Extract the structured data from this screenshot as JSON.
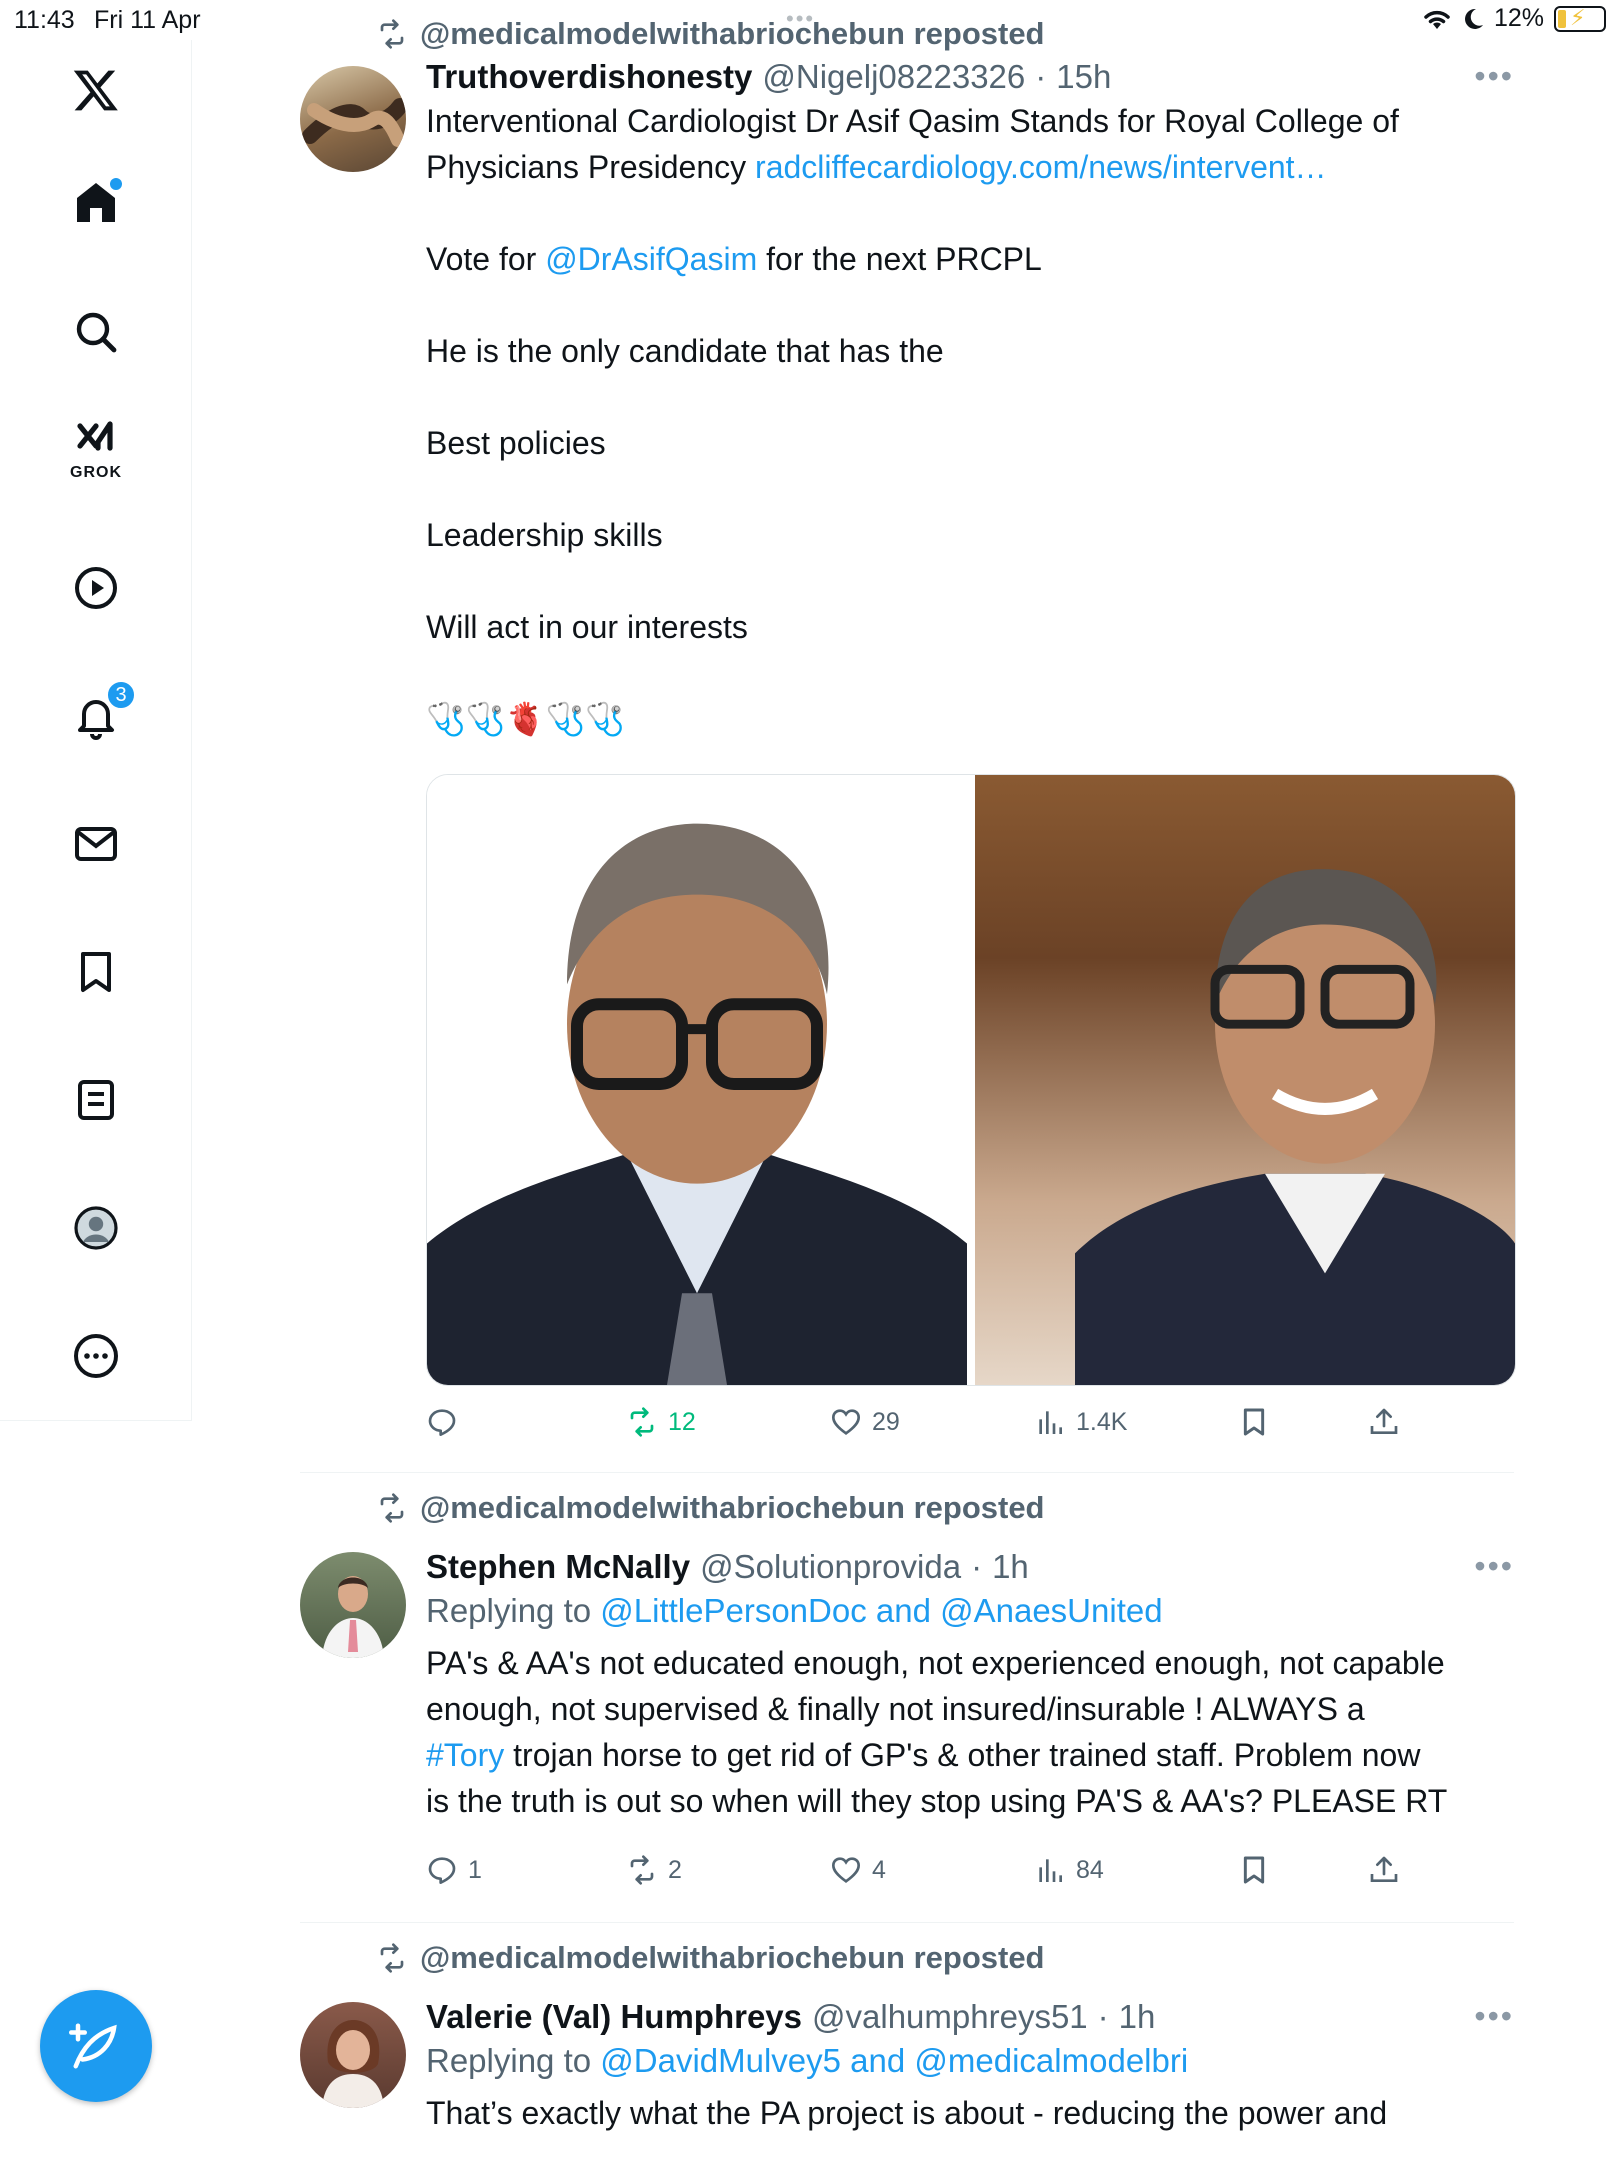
{
  "status_bar": {
    "time": "11:43",
    "date": "Fri 11 Apr",
    "battery": "12%"
  },
  "colors": {
    "accent": "#1d9bf0",
    "retweet_active": "#00ba7c",
    "secondary_text": "#536471"
  },
  "sidebar": {
    "items": [
      {
        "icon": "x-logo-icon"
      },
      {
        "icon": "home-icon"
      },
      {
        "icon": "search-icon"
      },
      {
        "icon": "grok-icon",
        "label": "GROK"
      },
      {
        "icon": "video-play-icon"
      },
      {
        "icon": "bell-icon",
        "badge": "3"
      },
      {
        "icon": "mail-icon"
      },
      {
        "icon": "bookmark-icon"
      },
      {
        "icon": "lists-icon"
      },
      {
        "icon": "profile-icon"
      },
      {
        "icon": "more-icon"
      }
    ],
    "compose_icon": "compose-feather-icon"
  },
  "tweets": [
    {
      "repost_text": "@medicalmodelwithabriochebun reposted",
      "name": "Truthoverdishonesty",
      "handle": "@Nigelj08223326",
      "time": "15h",
      "text_line1": "Interventional Cardiologist Dr Asif Qasim Stands for Royal College of",
      "text_line2a": "Physicians Presidency ",
      "link": "radcliffecardiology.com/news/intervent…",
      "vote_pre": "Vote for ",
      "vote_mention": "@DrAsifQasim",
      "vote_post": " for the next PRCPL",
      "line_candidate": "He is the only candidate that has the",
      "line_policies": "Best policies",
      "line_leadership": "Leadership skills",
      "line_interests": "Will act in our interests",
      "emoji_line": "🩺🩺🫀🩺🩺",
      "replies": "",
      "reposts": "12",
      "likes": "29",
      "views": "1.4K"
    },
    {
      "repost_text": "@medicalmodelwithabriochebun reposted",
      "name": "Stephen McNally",
      "handle": "@Solutionprovida",
      "time": "1h",
      "replying_label": "Replying to ",
      "replying_to": "@LittlePersonDoc and @AnaesUnited",
      "text_l1": "PA's & AA's not educated enough, not experienced enough, not capable",
      "text_l2": "enough, not supervised & finally not insured/insurable ! ALWAYS a",
      "hashtag": "#Tory",
      "text_l3": " trojan horse to get rid of GP's & other trained staff. Problem now",
      "text_l4": "is the truth is out so when will they stop using PA'S & AA's? PLEASE RT",
      "replies": "1",
      "reposts": "2",
      "likes": "4",
      "views": "84"
    },
    {
      "repost_text": "@medicalmodelwithabriochebun reposted",
      "name": "Valerie (Val) Humphreys",
      "handle": "@valhumphreys51",
      "time": "1h",
      "replying_label": "Replying to ",
      "replying_to": "@DavidMulvey5 and @medicalmodelbri",
      "text_l1": "That’s exactly what the PA project is about - reducing the power and"
    }
  ]
}
